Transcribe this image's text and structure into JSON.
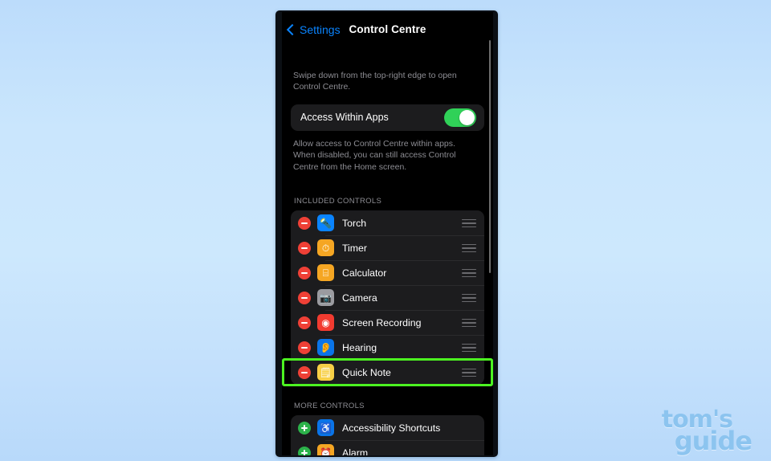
{
  "background": {
    "gradient_top": "#bcdcfb",
    "gradient_bottom": "#b8d9fa"
  },
  "watermark": {
    "line1": "tom's",
    "line2": "guide",
    "color": "#8cc4ef"
  },
  "navbar": {
    "back_label": "Settings",
    "back_icon": "chevron-left-icon",
    "title": "Control Centre",
    "accent_color": "#0a84ff"
  },
  "intro": {
    "text": "Swipe down from the top-right edge to open Control Centre."
  },
  "access_within_apps": {
    "label": "Access Within Apps",
    "toggle_state": "on",
    "toggle_color": "#30d158",
    "footnote": "Allow access to Control Centre within apps. When disabled, you can still access Control Centre from the Home screen."
  },
  "included_controls": {
    "header": "INCLUDED CONTROLS",
    "items": [
      {
        "label": "Torch",
        "action": "remove",
        "icon_name": "torch-icon",
        "icon_glyph": "🔦",
        "icon_bg": "#0a84ff",
        "icon_fg": "#ffffff"
      },
      {
        "label": "Timer",
        "action": "remove",
        "icon_name": "timer-icon",
        "icon_glyph": "⏱",
        "icon_bg": "#f5a623",
        "icon_fg": "#ffffff"
      },
      {
        "label": "Calculator",
        "action": "remove",
        "icon_name": "calculator-icon",
        "icon_glyph": "⌸",
        "icon_bg": "#f5a623",
        "icon_fg": "#ffffff"
      },
      {
        "label": "Camera",
        "action": "remove",
        "icon_name": "camera-icon",
        "icon_glyph": "📷",
        "icon_bg": "#9b9ba0",
        "icon_fg": "#ffffff"
      },
      {
        "label": "Screen Recording",
        "action": "remove",
        "icon_name": "screen-recording-icon",
        "icon_glyph": "◉",
        "icon_bg": "#f23b30",
        "icon_fg": "#ffffff"
      },
      {
        "label": "Hearing",
        "action": "remove",
        "icon_name": "hearing-icon",
        "icon_glyph": "👂",
        "icon_bg": "#0a74e8",
        "icon_fg": "#ffffff"
      },
      {
        "label": "Quick Note",
        "action": "remove",
        "icon_name": "quick-note-icon",
        "icon_glyph": "🗒",
        "icon_bg": "#f7cf46",
        "icon_fg": "#ffffff"
      }
    ]
  },
  "more_controls": {
    "header": "MORE CONTROLS",
    "items": [
      {
        "label": "Accessibility Shortcuts",
        "action": "add",
        "icon_name": "accessibility-icon",
        "icon_glyph": "♿",
        "icon_bg": "#0a74e8",
        "icon_fg": "#ffffff"
      },
      {
        "label": "Alarm",
        "action": "add",
        "icon_name": "alarm-icon",
        "icon_glyph": "⏰",
        "icon_bg": "#f5a623",
        "icon_fg": "#ffffff"
      }
    ]
  },
  "annotation": {
    "highlight_target": "Quick Note",
    "highlight_color": "#4cf321"
  }
}
